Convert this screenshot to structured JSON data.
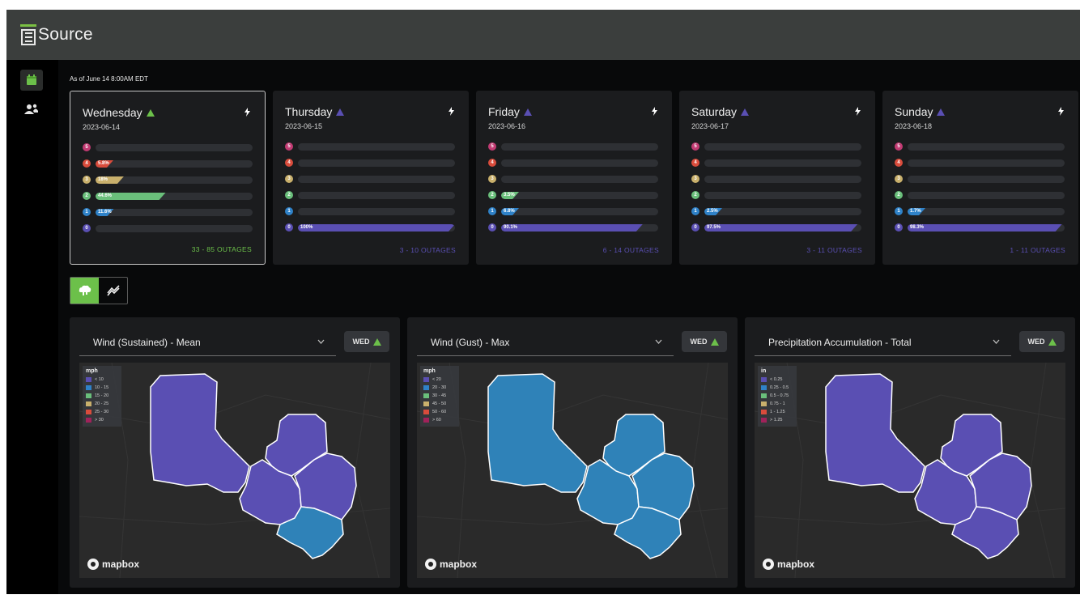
{
  "app": {
    "logo_letter": "E",
    "logo_text": "Source"
  },
  "sidebar": {
    "items": [
      {
        "name": "calendar",
        "icon": "calendar-icon",
        "active": true,
        "color": "#6cc04a"
      },
      {
        "name": "users",
        "icon": "users-icon",
        "active": false
      }
    ]
  },
  "as_of": "As of June 14 8:00AM EDT",
  "colors": {
    "lvl5": "#c23b73",
    "lvl4": "#d94c3c",
    "lvl3": "#c9b06c",
    "lvl2": "#6abf7b",
    "lvl1": "#2f82c8",
    "lvl0": "#5a4fb3",
    "accent": "#6cc04a",
    "up_green": "#6cc04a",
    "up_purple": "#5a4fb3",
    "region_purple": "#5a4fb3",
    "region_blue": "#2f82b8"
  },
  "days": [
    {
      "name": "Wednesday",
      "trend": "up",
      "trend_color": "#6cc04a",
      "date": "2023-06-14",
      "selected": true,
      "levels": [
        {
          "level": "5",
          "pct_label": "",
          "value": 0
        },
        {
          "level": "4",
          "pct_label": "5.8%",
          "value": 5.8
        },
        {
          "level": "3",
          "pct_label": "18%",
          "value": 18
        },
        {
          "level": "2",
          "pct_label": "44.6%",
          "value": 44.6
        },
        {
          "level": "1",
          "pct_label": "11.6%",
          "value": 11.6
        },
        {
          "level": "0",
          "pct_label": "",
          "value": 0
        }
      ],
      "outages": "33 - 85 OUTAGES",
      "outages_color": "#6cc04a"
    },
    {
      "name": "Thursday",
      "trend": "up",
      "trend_color": "#5a4fb3",
      "date": "2023-06-15",
      "selected": false,
      "levels": [
        {
          "level": "5",
          "pct_label": "",
          "value": 0
        },
        {
          "level": "4",
          "pct_label": "",
          "value": 0
        },
        {
          "level": "3",
          "pct_label": "",
          "value": 0
        },
        {
          "level": "2",
          "pct_label": "",
          "value": 0
        },
        {
          "level": "1",
          "pct_label": "",
          "value": 0
        },
        {
          "level": "0",
          "pct_label": "100%",
          "value": 100
        }
      ],
      "outages": "3 - 10 OUTAGES",
      "outages_color": "#5a4fb3"
    },
    {
      "name": "Friday",
      "trend": "up",
      "trend_color": "#5a4fb3",
      "date": "2023-06-16",
      "selected": false,
      "levels": [
        {
          "level": "5",
          "pct_label": "",
          "value": 0
        },
        {
          "level": "4",
          "pct_label": "",
          "value": 0
        },
        {
          "level": "3",
          "pct_label": "",
          "value": 0
        },
        {
          "level": "2",
          "pct_label": "3.5%",
          "value": 3.5
        },
        {
          "level": "1",
          "pct_label": "6.8%",
          "value": 6.8
        },
        {
          "level": "0",
          "pct_label": "90.1%",
          "value": 90.1
        }
      ],
      "outages": "6 - 14 OUTAGES",
      "outages_color": "#5a4fb3"
    },
    {
      "name": "Saturday",
      "trend": "up",
      "trend_color": "#5a4fb3",
      "date": "2023-06-17",
      "selected": false,
      "levels": [
        {
          "level": "5",
          "pct_label": "",
          "value": 0
        },
        {
          "level": "4",
          "pct_label": "",
          "value": 0
        },
        {
          "level": "3",
          "pct_label": "",
          "value": 0
        },
        {
          "level": "2",
          "pct_label": "",
          "value": 0
        },
        {
          "level": "1",
          "pct_label": "2.5%",
          "value": 2.5
        },
        {
          "level": "0",
          "pct_label": "97.5%",
          "value": 97.5
        }
      ],
      "outages": "3 - 11 OUTAGES",
      "outages_color": "#5a4fb3"
    },
    {
      "name": "Sunday",
      "trend": "up",
      "trend_color": "#5a4fb3",
      "date": "2023-06-18",
      "selected": false,
      "levels": [
        {
          "level": "5",
          "pct_label": "",
          "value": 0
        },
        {
          "level": "4",
          "pct_label": "",
          "value": 0
        },
        {
          "level": "3",
          "pct_label": "",
          "value": 0
        },
        {
          "level": "2",
          "pct_label": "",
          "value": 0
        },
        {
          "level": "1",
          "pct_label": "1.7%",
          "value": 1.7
        },
        {
          "level": "0",
          "pct_label": "98.3%",
          "value": 98.3
        }
      ],
      "outages": "1 - 11 OUTAGES",
      "outages_color": "#5a4fb3"
    }
  ],
  "view_toggle": {
    "active": "map",
    "map_icon": "map-icon",
    "chart_icon": "chart-icon"
  },
  "map_panels": [
    {
      "title": "Wind (Sustained) - Mean",
      "day": "WED",
      "unit": "mph",
      "legend": [
        "< 10",
        "10 - 15",
        "15 - 20",
        "20 - 25",
        "25 - 30",
        "> 30"
      ],
      "region_colors": [
        "#5a4fb3",
        "#5a4fb3",
        "#5a4fb3",
        "#5a4fb3",
        "#2f82b8"
      ],
      "attribution": "mapbox"
    },
    {
      "title": "Wind (Gust) - Max",
      "day": "WED",
      "unit": "mph",
      "legend": [
        "< 20",
        "20 - 30",
        "30 - 45",
        "45 - 50",
        "50 - 60",
        "> 60"
      ],
      "region_colors": [
        "#2f82b8",
        "#2f82b8",
        "#2f82b8",
        "#2f82b8",
        "#2f82b8"
      ],
      "attribution": "mapbox"
    },
    {
      "title": "Precipitation Accumulation - Total",
      "day": "WED",
      "unit": "in",
      "legend": [
        "< 0.25",
        "0.25 - 0.5",
        "0.5 - 0.75",
        "0.75 - 1",
        "1 - 1.25",
        "> 1.25"
      ],
      "region_colors": [
        "#5a4fb3",
        "#5a4fb3",
        "#5a4fb3",
        "#5a4fb3",
        "#5a4fb3"
      ],
      "attribution": "mapbox"
    }
  ]
}
